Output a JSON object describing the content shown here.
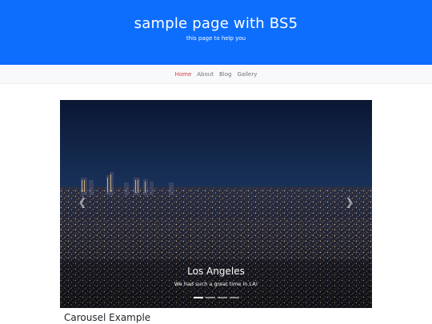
{
  "header": {
    "title": "sample page with BS5",
    "subtitle": "this page to help you"
  },
  "nav": {
    "items": [
      "Home",
      "About",
      "Blog",
      "Gallery"
    ],
    "active": "Home"
  },
  "carousel": {
    "slides": [
      {
        "title": "Los Angeles",
        "text": "We had such a great time in LA!"
      }
    ],
    "indicator_count": 4,
    "active_index": 0,
    "prev_icon": "chevron-left-icon",
    "next_icon": "chevron-right-icon"
  },
  "section": {
    "title": "Carousel Example"
  },
  "colors": {
    "header_bg": "#0d6efd",
    "nav_bg": "#f8f9fa",
    "nav_active": "#dc3545",
    "nav_link": "#6c757d"
  }
}
